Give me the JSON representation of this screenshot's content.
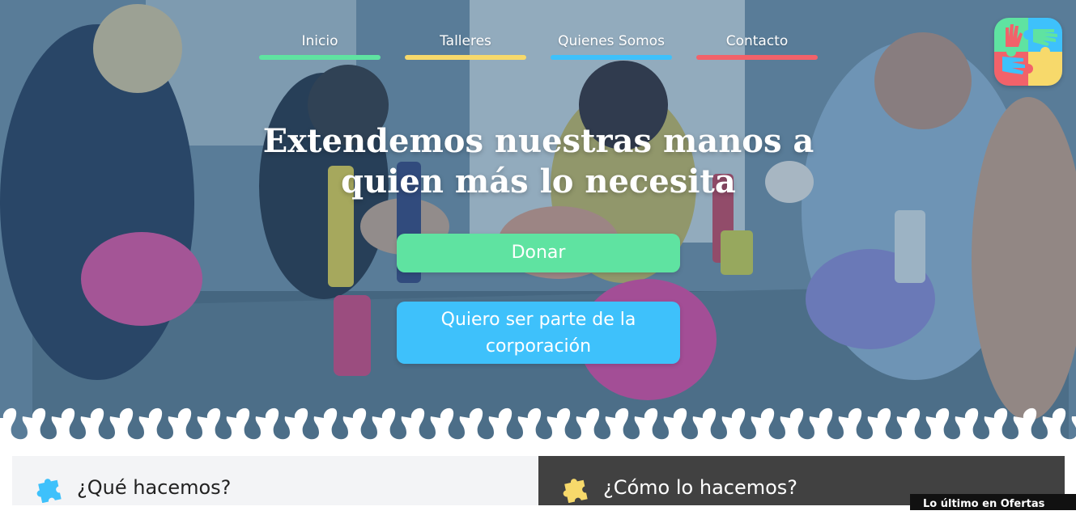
{
  "nav": {
    "items": [
      {
        "label": "Inicio",
        "color": "#5fe3a1"
      },
      {
        "label": "Talleres",
        "color": "#f7d96b"
      },
      {
        "label": "Quienes Somos",
        "color": "#3ec1fb"
      },
      {
        "label": "Contacto",
        "color": "#f2626a"
      }
    ]
  },
  "hero": {
    "headline_line1": "Extendemos nuestras manos a",
    "headline_line2": "quien más lo necesita",
    "donate_label": "Donar",
    "join_label": "Quiero ser parte de la corporación",
    "donate_color": "#5fe3a1",
    "join_color": "#3ec1fb"
  },
  "logo": {
    "icon": "hands-puzzle-logo",
    "colors": [
      "#f2626a",
      "#3ec1fb",
      "#5fe3a1",
      "#f7d96b"
    ]
  },
  "sections": {
    "what": {
      "title": "¿Qué hacemos?",
      "icon": "puzzle-piece-icon",
      "icon_color": "#3ec1fb"
    },
    "how": {
      "title": "¿Cómo lo hacemos?",
      "icon": "puzzle-piece-icon",
      "icon_color": "#f7d96b"
    }
  },
  "chat_tab": {
    "label": "Lo último en Ofertas"
  }
}
